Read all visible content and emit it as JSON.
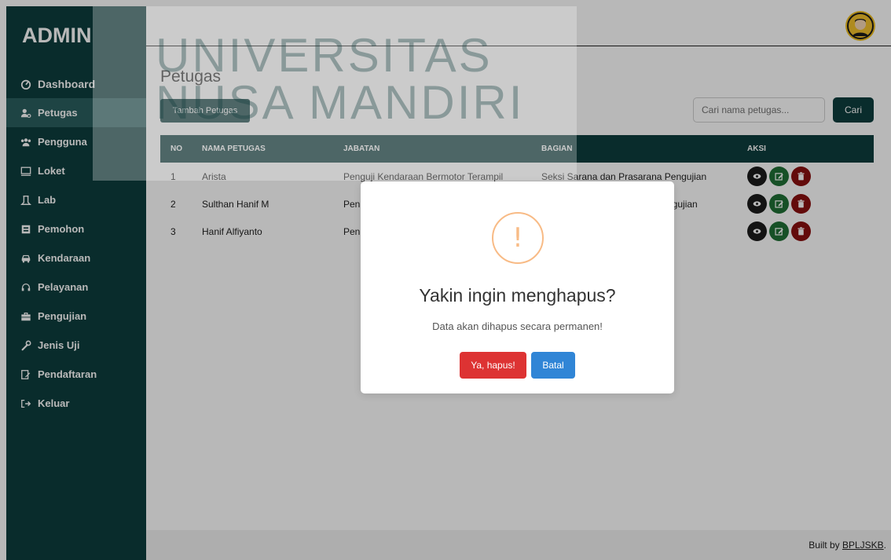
{
  "sidebar": {
    "brand": "ADMIN",
    "items": [
      {
        "label": "Dashboard",
        "icon": "dashboard-icon"
      },
      {
        "label": "Petugas",
        "icon": "users-cog-icon",
        "active": true
      },
      {
        "label": "Pengguna",
        "icon": "users-icon"
      },
      {
        "label": "Loket",
        "icon": "desktop-icon"
      },
      {
        "label": "Lab",
        "icon": "flask-icon"
      },
      {
        "label": "Pemohon",
        "icon": "id-card-icon"
      },
      {
        "label": "Kendaraan",
        "icon": "car-icon"
      },
      {
        "label": "Pelayanan",
        "icon": "headset-icon"
      },
      {
        "label": "Pengujian",
        "icon": "briefcase-icon"
      },
      {
        "label": "Jenis Uji",
        "icon": "wrench-icon"
      },
      {
        "label": "Pendaftaran",
        "icon": "signature-icon"
      },
      {
        "label": "Keluar",
        "icon": "sign-out-icon"
      }
    ]
  },
  "main": {
    "title": "Petugas",
    "add_button": "Tambah Petugas",
    "search": {
      "placeholder": "Cari nama petugas...",
      "button": "Cari"
    },
    "table": {
      "headers": [
        "NO",
        "NAMA PETUGAS",
        "JABATAN",
        "BAGIAN",
        "AKSI"
      ],
      "rows": [
        {
          "no": "1",
          "nama": "Arista",
          "jabatan": "Penguji Kendaraan Bermotor Terampil",
          "bagian": "Seksi Sarana dan Prasarana Pengujian"
        },
        {
          "no": "2",
          "nama": "Sulthan Hanif M",
          "jabatan": "Pen",
          "bagian": "ngujian"
        },
        {
          "no": "3",
          "nama": "Hanif Alfiyanto",
          "jabatan": "Pen",
          "bagian": ""
        }
      ]
    }
  },
  "footer": {
    "prefix": "Built by ",
    "link": "BPLJSKB",
    "suffix": "."
  },
  "watermark": {
    "line1": "UNIVERSITAS",
    "line2": "NUSA MANDIRI"
  },
  "dialog": {
    "title": "Yakin ingin menghapus?",
    "text": "Data akan dihapus secara permanen!",
    "confirm": "Ya, hapus!",
    "cancel": "Batal",
    "icon": "warning-icon"
  },
  "colors": {
    "sidebar": "#0d3d3d",
    "active": "#2a5f5f",
    "danger": "#dd3333",
    "primary": "#3085d6",
    "warning": "#f8bb86"
  }
}
